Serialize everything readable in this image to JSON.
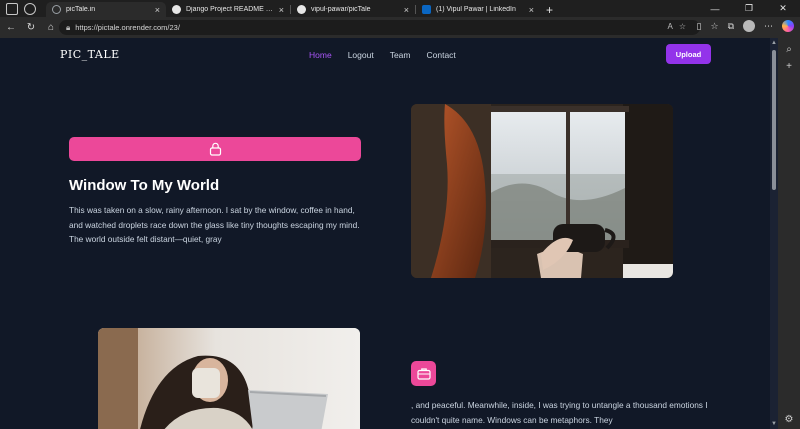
{
  "browser": {
    "tabs": [
      {
        "label": "picTale.in",
        "favicon": "globe-icon",
        "color": "#9aa0a6",
        "active": true
      },
      {
        "label": "Django Project README Creation",
        "favicon": "chatgpt-icon",
        "color": "#e6e6e6",
        "active": false
      },
      {
        "label": "vipul-pawar/picTale",
        "favicon": "github-icon",
        "color": "#e6e6e6",
        "active": false
      },
      {
        "label": "(1) Vipul Pawar | LinkedIn",
        "favicon": "linkedin-icon",
        "color": "#0a66c2",
        "active": false
      }
    ],
    "url": "https://pictale.onrender.com/23/"
  },
  "site": {
    "brand": "PIC_TALE",
    "nav": [
      "Home",
      "Logout",
      "Team",
      "Contact"
    ],
    "active_nav": "Home",
    "upload_label": "Upload",
    "accent": "#a855f7",
    "button_color": "#9333ea",
    "pink": "#ec4899"
  },
  "post1": {
    "title": "Window To My World",
    "body": "This was taken on a slow, rainy afternoon. I sat by the window, coffee in hand, and watched droplets race down the glass like tiny thoughts escaping my mind. The world outside felt distant—quiet, gray",
    "bar_icon": "lock-icon"
  },
  "post2": {
    "icon": "briefcase-icon",
    "body": ", and peaceful. Meanwhile, inside, I was trying to untangle a thousand emotions I couldn't quite name. Windows can be metaphors. They"
  }
}
